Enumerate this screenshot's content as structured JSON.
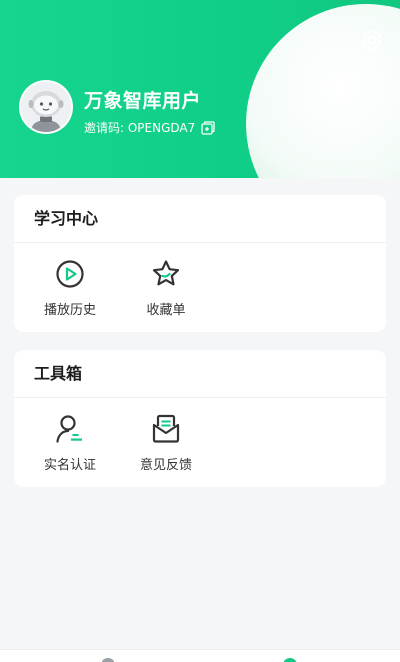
{
  "profile": {
    "username": "万象智库用户",
    "invite_label": "邀请码: OPENGDA7"
  },
  "study_center": {
    "title": "学习中心",
    "items": [
      {
        "label": "播放历史",
        "icon": "play-circle-icon"
      },
      {
        "label": "收藏单",
        "icon": "star-icon"
      }
    ]
  },
  "toolbox": {
    "title": "工具箱",
    "items": [
      {
        "label": "实名认证",
        "icon": "user-verify-icon"
      },
      {
        "label": "意见反馈",
        "icon": "feedback-mail-icon"
      }
    ]
  },
  "colors": {
    "brand": "#12d28b",
    "icon": "#333333",
    "accent": "#13c985"
  }
}
